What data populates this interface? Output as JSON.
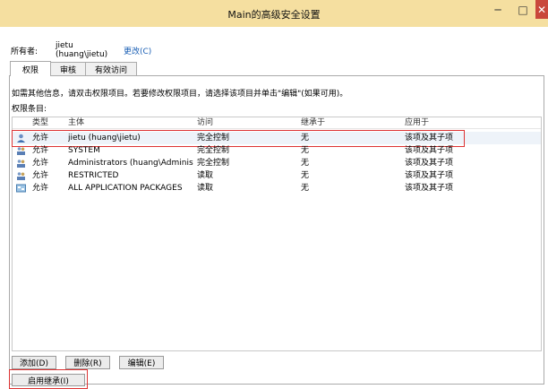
{
  "window": {
    "title": "Main的高级安全设置",
    "min": "─",
    "max": "□",
    "close": "✕"
  },
  "owner": {
    "label": "所有者:",
    "value": "jietu (huang\\jietu)",
    "change": "更改(C)"
  },
  "tabs": [
    {
      "label": "权限",
      "active": true
    },
    {
      "label": "审核",
      "active": false
    },
    {
      "label": "有效访问",
      "active": false
    }
  ],
  "info_text": "如需其他信息，请双击权限项目。若要修改权限项目，请选择该项目并单击\"编辑\"(如果可用)。",
  "entries_label": "权限条目:",
  "columns": [
    "类型",
    "主体",
    "访问",
    "继承于",
    "应用于"
  ],
  "rows": [
    {
      "type": "允许",
      "principal": "jietu (huang\\jietu)",
      "access": "完全控制",
      "inherited": "无",
      "applies": "该项及其子项",
      "icon": "user-icon"
    },
    {
      "type": "允许",
      "principal": "SYSTEM",
      "access": "完全控制",
      "inherited": "无",
      "applies": "该项及其子项",
      "icon": "group-icon"
    },
    {
      "type": "允许",
      "principal": "Administrators (huang\\Administr...",
      "access": "完全控制",
      "inherited": "无",
      "applies": "该项及其子项",
      "icon": "group-icon"
    },
    {
      "type": "允许",
      "principal": "RESTRICTED",
      "access": "读取",
      "inherited": "无",
      "applies": "该项及其子项",
      "icon": "group-icon"
    },
    {
      "type": "允许",
      "principal": "ALL APPLICATION PACKAGES",
      "access": "读取",
      "inherited": "无",
      "applies": "该项及其子项",
      "icon": "package-icon"
    }
  ],
  "buttons": {
    "add": "添加(D)",
    "remove": "删除(R)",
    "edit": "编辑(E)",
    "enable_inheritance": "启用继承(I)"
  },
  "colors": {
    "titlebar": "#f5dfa0",
    "highlight": "#dd3333",
    "link": "#1a5fb4"
  }
}
